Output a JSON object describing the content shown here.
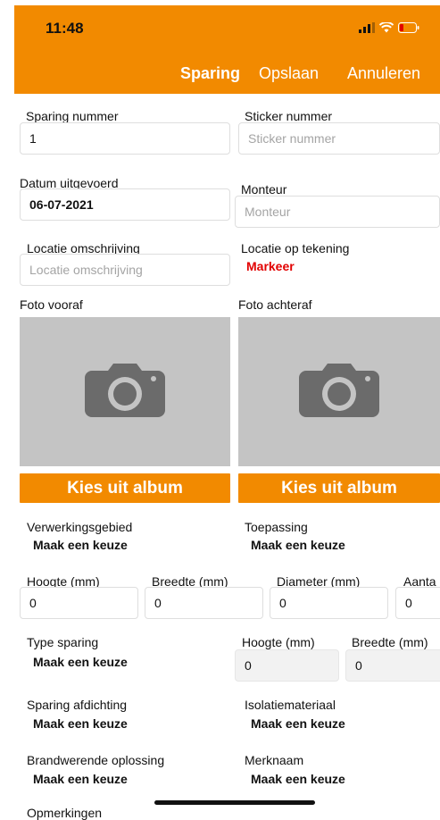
{
  "status": {
    "time": "11:48"
  },
  "header": {
    "title": "Sparing",
    "save_label": "Opslaan",
    "cancel_label": "Annuleren",
    "color": "#f28a00"
  },
  "form": {
    "sparing_nummer": {
      "label": "Sparing nummer",
      "value": "1"
    },
    "sticker_nummer": {
      "label": "Sticker nummer",
      "placeholder": "Sticker nummer"
    },
    "datum": {
      "label": "Datum uitgevoerd",
      "value": "06-07-2021"
    },
    "monteur": {
      "label": "Monteur",
      "placeholder": "Monteur"
    },
    "locatie_omschrijving": {
      "label": "Locatie omschrijving",
      "placeholder": "Locatie omschrijving"
    },
    "locatie_tekening": {
      "label": "Locatie op tekening",
      "action": "Markeer"
    },
    "foto_vooraf": {
      "label": "Foto vooraf",
      "button": "Kies uit album"
    },
    "foto_achteraf": {
      "label": "Foto achteraf",
      "button": "Kies uit album"
    },
    "verwerkingsgebied": {
      "label": "Verwerkingsgebied",
      "value": "Maak een keuze"
    },
    "toepassing": {
      "label": "Toepassing",
      "value": "Maak een keuze"
    },
    "hoogte": {
      "label": "Hoogte (mm)",
      "value": "0"
    },
    "breedte": {
      "label": "Breedte (mm)",
      "value": "0"
    },
    "diameter": {
      "label": "Diameter (mm)",
      "value": "0"
    },
    "aantal": {
      "label": "Aanta",
      "value": "0"
    },
    "type_sparing": {
      "label": "Type sparing",
      "value": "Maak een keuze"
    },
    "type_hoogte": {
      "label": "Hoogte (mm)",
      "value": "0"
    },
    "type_breedte": {
      "label": "Breedte (mm)",
      "value": "0"
    },
    "sparing_afdichting": {
      "label": "Sparing afdichting",
      "value": "Maak een keuze"
    },
    "isolatiemateriaal": {
      "label": "Isolatiemateriaal",
      "value": "Maak een keuze"
    },
    "brandwerende_oplossing": {
      "label": "Brandwerende oplossing",
      "value": "Maak een keuze"
    },
    "merknaam": {
      "label": "Merknaam",
      "value": "Maak een keuze"
    },
    "opmerkingen": {
      "label": "Opmerkingen"
    }
  }
}
